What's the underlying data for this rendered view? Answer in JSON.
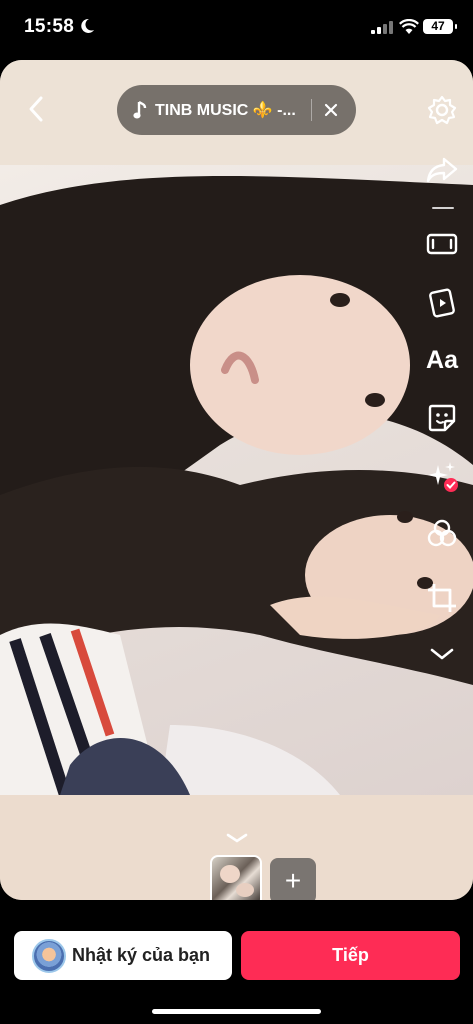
{
  "status_bar": {
    "time": "15:58",
    "battery": "47"
  },
  "music": {
    "title": "TINB MUSIC ⚜️ -..."
  },
  "tools": [
    "settings-icon",
    "share-icon",
    "film-frame-icon",
    "video-template-icon",
    "text-icon",
    "sticker-icon",
    "effects-icon",
    "filters-icon",
    "crop-icon",
    "expand-more-icon"
  ],
  "tools_text": {
    "text_tool": "Aa"
  },
  "bottom": {
    "add_label": "+",
    "diary_label": "Nhật ký của bạn",
    "next_label": "Tiếp"
  },
  "colors": {
    "accent": "#fe2c55",
    "pill": "#77716b",
    "canvas": "#ede0d4"
  }
}
